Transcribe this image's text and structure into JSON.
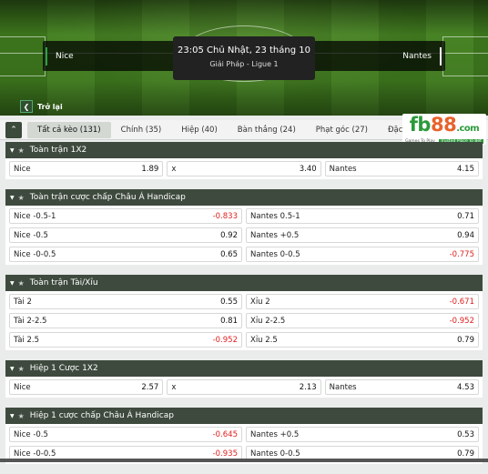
{
  "match": {
    "datetime": "23:05 Chủ Nhật, 23 tháng 10",
    "league": "Giải Pháp - Ligue 1",
    "home": "Nice",
    "away": "Nantes",
    "back_label": "Trở lại"
  },
  "tabs": [
    {
      "label": "Tất cả kèo (131)",
      "active": true
    },
    {
      "label": "Chính (35)"
    },
    {
      "label": "Hiệp (40)"
    },
    {
      "label": "Bàn thắng (24)"
    },
    {
      "label": "Phạt góc (27)"
    },
    {
      "label": "Đặc biệt (12)"
    }
  ],
  "logo": {
    "fb": "fb",
    "num": "88",
    "com": ".com",
    "tagline": "Games To Play",
    "badge": "Trusted Place To Bet"
  },
  "icons": {
    "collapse": "chevron-up-icon",
    "caret": "caret-down-icon",
    "star": "star-icon",
    "back": "chevron-left-icon"
  },
  "colors": {
    "negative": "#e0201f",
    "header": "#3e4a3e",
    "brand_green": "#2b9a3a",
    "brand_orange": "#e8622b"
  },
  "markets": [
    {
      "title": "Toàn trận 1X2",
      "rows": [
        [
          {
            "label": "Nice",
            "odd": "1.89"
          },
          {
            "label": "x",
            "odd": "3.40"
          },
          {
            "label": "Nantes",
            "odd": "4.15"
          }
        ]
      ]
    },
    {
      "title": "Toàn trận cược chấp Châu Á Handicap",
      "rows": [
        [
          {
            "label": "Nice -0.5-1",
            "odd": "-0.833",
            "neg": true
          },
          {
            "label": "Nantes 0.5-1",
            "odd": "0.71"
          }
        ],
        [
          {
            "label": "Nice -0.5",
            "odd": "0.92"
          },
          {
            "label": "Nantes +0.5",
            "odd": "0.94"
          }
        ],
        [
          {
            "label": "Nice -0-0.5",
            "odd": "0.65"
          },
          {
            "label": "Nantes 0-0.5",
            "odd": "-0.775",
            "neg": true
          }
        ]
      ]
    },
    {
      "title": "Toàn trận Tài/Xỉu",
      "rows": [
        [
          {
            "label": "Tài 2",
            "odd": "0.55"
          },
          {
            "label": "Xỉu 2",
            "odd": "-0.671",
            "neg": true
          }
        ],
        [
          {
            "label": "Tài 2-2.5",
            "odd": "0.81"
          },
          {
            "label": "Xỉu 2-2.5",
            "odd": "-0.952",
            "neg": true
          }
        ],
        [
          {
            "label": "Tài 2.5",
            "odd": "-0.952",
            "neg": true
          },
          {
            "label": "Xỉu 2.5",
            "odd": "0.79"
          }
        ]
      ]
    },
    {
      "title": "Hiệp 1 Cược 1X2",
      "rows": [
        [
          {
            "label": "Nice",
            "odd": "2.57"
          },
          {
            "label": "x",
            "odd": "2.13"
          },
          {
            "label": "Nantes",
            "odd": "4.53"
          }
        ]
      ]
    },
    {
      "title": "Hiệp 1 cược chấp Châu Á Handicap",
      "rows": [
        [
          {
            "label": "Nice -0.5",
            "odd": "-0.645",
            "neg": true
          },
          {
            "label": "Nantes +0.5",
            "odd": "0.53"
          }
        ],
        [
          {
            "label": "Nice -0-0.5",
            "odd": "-0.935",
            "neg": true
          },
          {
            "label": "Nantes 0-0.5",
            "odd": "0.79"
          }
        ]
      ]
    }
  ]
}
